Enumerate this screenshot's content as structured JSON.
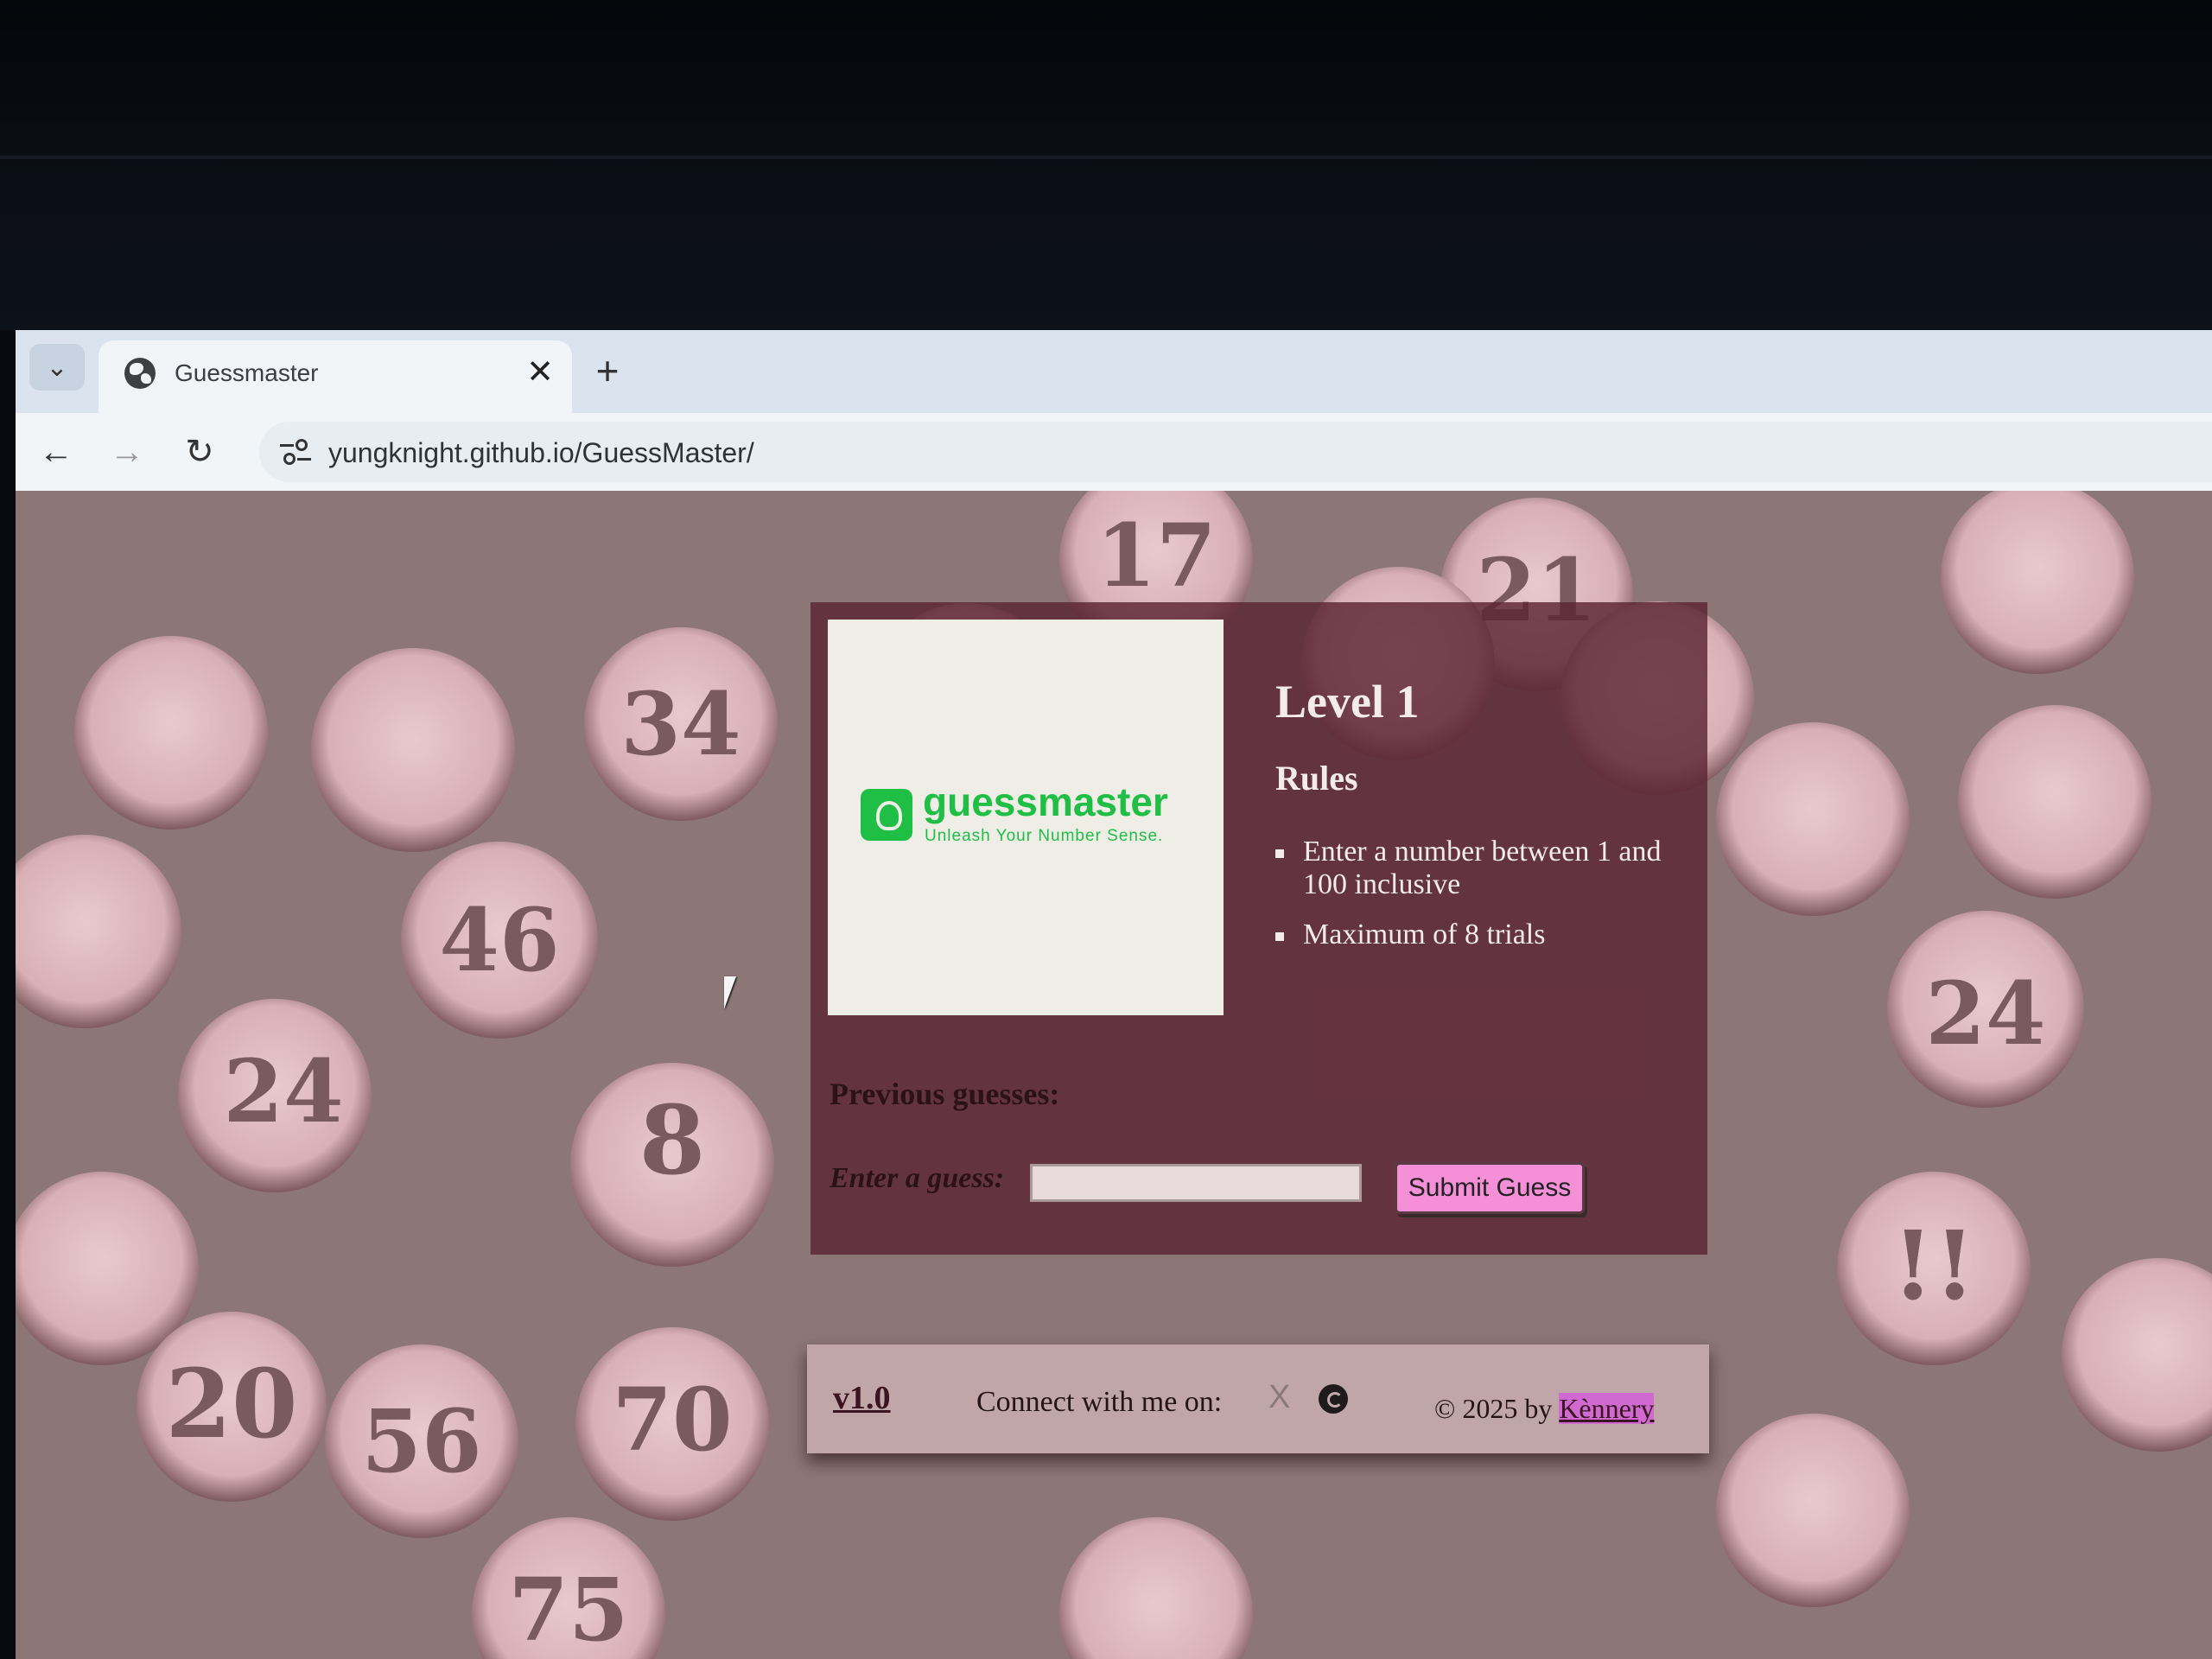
{
  "browser": {
    "tab_title": "Guessmaster",
    "url": "yungknight.github.io/GuessMaster/",
    "tab_close": "✕",
    "new_tab": "+",
    "tab_list": "⌄",
    "back": "←",
    "forward": "→",
    "reload": "↻"
  },
  "logo": {
    "name": "guessmaster",
    "tagline": "Unleash Your Number Sense."
  },
  "game": {
    "level": "Level 1",
    "rules_heading": "Rules",
    "rules": [
      "Enter a number between 1 and 100 inclusive",
      "Maximum of 8 trials"
    ],
    "previous_guesses_label": "Previous guesses:",
    "guess_label": "Enter a guess:",
    "guess_value": "",
    "submit_label": "Submit Guess"
  },
  "footer": {
    "version": "v1.0",
    "connect_text": "Connect with me on:",
    "x_icon": "X",
    "copyright_prefix": "© 2025 by",
    "author": "Kènnery"
  },
  "background_ball_numbers": [
    "8",
    "34",
    "24",
    "17",
    "21",
    "70",
    "20",
    "56",
    "75",
    "24",
    "!!",
    "46"
  ],
  "colors": {
    "card_bg": "#5c2434",
    "submit_bg": "#f48fd8",
    "logo_green": "#1fbf45",
    "footer_bg": "#c4aaac"
  }
}
